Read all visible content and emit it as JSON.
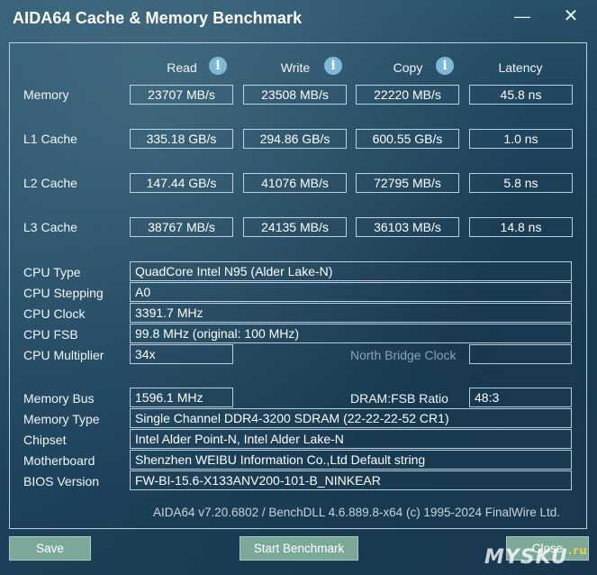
{
  "window": {
    "title": "AIDA64 Cache & Memory Benchmark",
    "minimize_glyph": "—",
    "close_glyph": "✕"
  },
  "columns": {
    "read": "Read",
    "write": "Write",
    "copy": "Copy",
    "latency": "Latency",
    "info_glyph": "i"
  },
  "results": {
    "memory": {
      "label": "Memory",
      "read": "23707 MB/s",
      "write": "23508 MB/s",
      "copy": "22220 MB/s",
      "latency": "45.8 ns"
    },
    "l1": {
      "label": "L1 Cache",
      "read": "335.18 GB/s",
      "write": "294.86 GB/s",
      "copy": "600.55 GB/s",
      "latency": "1.0 ns"
    },
    "l2": {
      "label": "L2 Cache",
      "read": "147.44 GB/s",
      "write": "41076 MB/s",
      "copy": "72795 MB/s",
      "latency": "5.8 ns"
    },
    "l3": {
      "label": "L3 Cache",
      "read": "38767 MB/s",
      "write": "24135 MB/s",
      "copy": "36103 MB/s",
      "latency": "14.8 ns"
    }
  },
  "cpu": {
    "type_label": "CPU Type",
    "type": "QuadCore Intel N95  (Alder Lake-N)",
    "stepping_label": "CPU Stepping",
    "stepping": "A0",
    "clock_label": "CPU Clock",
    "clock": "3391.7 MHz",
    "fsb_label": "CPU FSB",
    "fsb": "99.8 MHz  (original: 100 MHz)",
    "multiplier_label": "CPU Multiplier",
    "multiplier": "34x",
    "nb_clock_label": "North Bridge Clock",
    "nb_clock": ""
  },
  "memory": {
    "bus_label": "Memory Bus",
    "bus": "1596.1 MHz",
    "dram_fsb_label": "DRAM:FSB Ratio",
    "dram_fsb": "48:3",
    "type_label": "Memory Type",
    "type": "Single Channel DDR4-3200 SDRAM  (22-22-22-52 CR1)",
    "chipset_label": "Chipset",
    "chipset": "Intel Alder Point-N, Intel Alder Lake-N",
    "motherboard_label": "Motherboard",
    "motherboard": "Shenzhen WEIBU Information Co.,Ltd Default string",
    "bios_label": "BIOS Version",
    "bios": "FW-BI-15.6-X133ANV200-101-B_NINKEAR"
  },
  "footer": {
    "version": "AIDA64 v7.20.6802 / BenchDLL 4.6.889.8-x64  (c) 1995-2024 FinalWire Ltd."
  },
  "buttons": {
    "save": "Save",
    "start": "Start Benchmark",
    "close": "Close"
  },
  "watermark": {
    "text": "MYSKU",
    "suffix": ".ru"
  }
}
